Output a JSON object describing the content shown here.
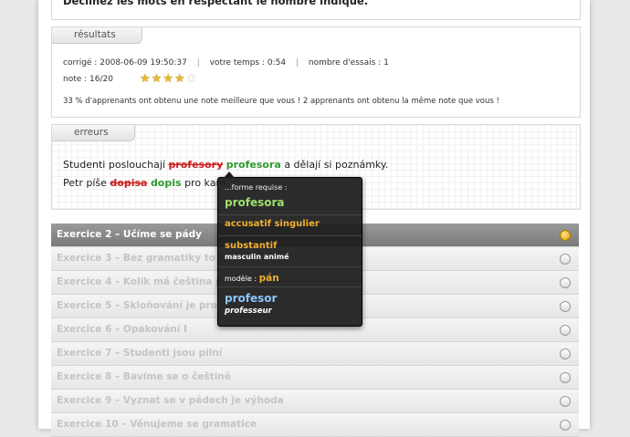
{
  "instruction": "Déclinez les mots en respectant le nombre indiqué.",
  "results": {
    "tab": "résultats",
    "corrected_label": "corrigé :",
    "corrected_value": "2008-06-09 19:50:37",
    "time_label": "votre temps :",
    "time_value": "0:54",
    "tries_label": "nombre d'essais :",
    "tries_value": "1",
    "note_label": "note :",
    "note_value": "16/20",
    "stars_filled": 4,
    "stars_total": 5,
    "comparison": "33 % d'apprenants ont obtenu une note meilleure que vous ! 2 apprenants ont obtenu la même note que vous !"
  },
  "errors": {
    "tab": "erreurs",
    "s1_pre": "Studenti poslouchají",
    "s1_wrong": "profesory",
    "s1_right": "profesora",
    "s1_post": "a dělají si poznámky.",
    "s2_pre": "Petr píše",
    "s2_wrong": "dopisa",
    "s2_right": "dopis",
    "s2_post": "pro kam"
  },
  "tooltip": {
    "required": "...forme requise :",
    "form": "profesora",
    "case": "accusatif singulier",
    "pos": "substantif",
    "gender": "masculin animé",
    "model_label": "modèle :",
    "model": "pán",
    "lemma": "profesor",
    "translation": "professeur"
  },
  "exercises": [
    {
      "label": "Exercice 2 – Učíme se pády",
      "active": true
    },
    {
      "label": "Exercice 3 – Bez gramatiky to n",
      "active": false
    },
    {
      "label": "Exercice 4 – Kolik má čeština p",
      "active": false
    },
    {
      "label": "Exercice 5 – Skloňování je pro n",
      "active": false
    },
    {
      "label": "Exercice 6 – Opakování I",
      "active": false
    },
    {
      "label": "Exercice 7 – Studenti jsou pilní",
      "active": false
    },
    {
      "label": "Exercice 8 – Bavíme se o češtině",
      "active": false
    },
    {
      "label": "Exercice 9 – Vyznat se v pádech je výhoda",
      "active": false
    },
    {
      "label": "Exercice 10 – Věnujeme se gramatice",
      "active": false
    }
  ],
  "colors": {
    "wrong": "#cc2020",
    "right": "#2f9a2f",
    "accent": "#f0b030",
    "active_row": "#8a8a8a"
  }
}
